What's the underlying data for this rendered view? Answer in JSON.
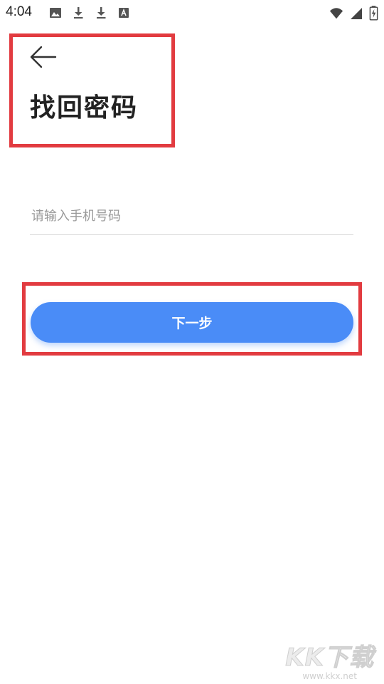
{
  "status_bar": {
    "time": "4:04",
    "left_icons": [
      "image-icon",
      "download-icon",
      "download-icon",
      "font-icon"
    ],
    "right_icons": [
      "wifi-icon",
      "cell-signal-icon",
      "battery-charging-icon"
    ]
  },
  "header": {
    "back_icon": "arrow-left-icon",
    "title": "找回密码"
  },
  "form": {
    "phone_placeholder": "请输入手机号码",
    "phone_value": "",
    "next_label": "下一步"
  },
  "watermark": {
    "logo": "KK下载",
    "url": "www.kkx.net"
  },
  "colors": {
    "primary_button": "#4a8cf7",
    "highlight_border": "#e23b40",
    "title_text": "#222222",
    "placeholder_text": "#9a9a9a",
    "divider": "#d8d8d8"
  }
}
